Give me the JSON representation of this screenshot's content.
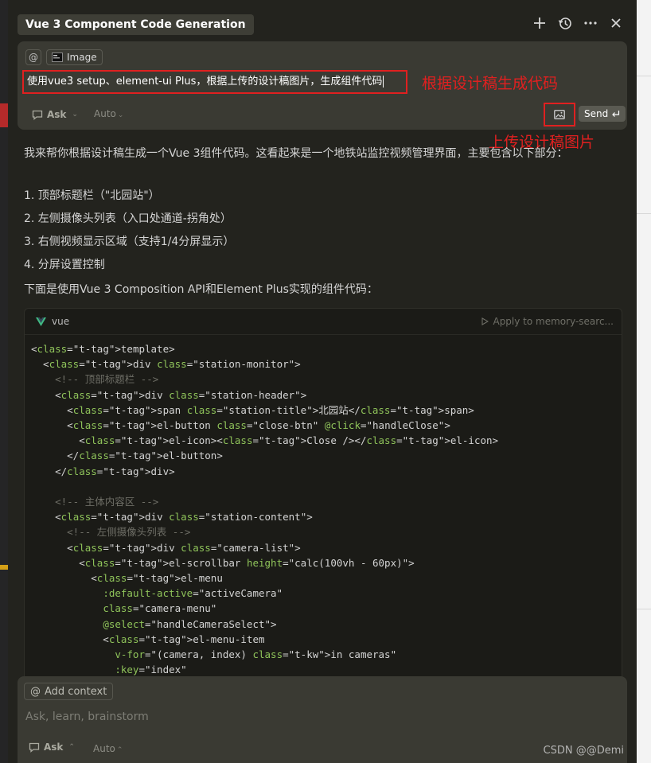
{
  "window": {
    "title": "Vue 3 Component Code Generation",
    "actions": [
      "new-chat-icon",
      "history-icon",
      "more-icon",
      "close-icon"
    ]
  },
  "composer": {
    "at_symbol": "@",
    "attachment_label": "Image",
    "prompt": "使用vue3 setup、element-ui Plus，根据上传的设计稿图片，生成组件代码",
    "mode": "Ask",
    "model": "Auto",
    "send_label": "Send"
  },
  "annotations": {
    "prompt_note": "根据设计稿生成代码",
    "upload_note": "上传设计稿图片"
  },
  "response": {
    "intro": "我来帮你根据设计稿生成一个Vue 3组件代码。这看起来是一个地铁站监控视频管理界面，主要包含以下部分：",
    "items": [
      "1. 顶部标题栏（\"北园站\"）",
      "2. 左侧摄像头列表（入口处通道-拐角处）",
      "3. 右侧视频显示区域（支持1/4分屏显示）",
      "4. 分屏设置控制"
    ],
    "lead": "下面是使用Vue 3 Composition API和Element Plus实现的组件代码："
  },
  "code_block": {
    "language": "vue",
    "apply_label": "Apply to memory-searc...",
    "lines": [
      "<template>",
      "  <div class=\"station-monitor\">",
      "    <!-- 顶部标题栏 -->",
      "    <div class=\"station-header\">",
      "      <span class=\"station-title\">北园站</span>",
      "      <el-button class=\"close-btn\" @click=\"handleClose\">",
      "        <el-icon><Close /></el-icon>",
      "      </el-button>",
      "    </div>",
      "",
      "    <!-- 主体内容区 -->",
      "    <div class=\"station-content\">",
      "      <!-- 左侧摄像头列表 -->",
      "      <div class=\"camera-list\">",
      "        <el-scrollbar height=\"calc(100vh - 60px)\">",
      "          <el-menu",
      "            :default-active=\"activeCamera\"",
      "            class=\"camera-menu\"",
      "            @select=\"handleCameraSelect\">",
      "            <el-menu-item",
      "              v-for=\"(camera, index) in cameras\"",
      "              :key=\"index\""
    ]
  },
  "bottom_composer": {
    "context_label": "Add context",
    "placeholder": "Ask, learn, brainstorm",
    "mode": "Ask",
    "model": "Auto"
  },
  "watermark": "CSDN @@Demi",
  "colors": {
    "panel_bg": "#23231e",
    "composer_bg": "#3a3a33",
    "annotation_red": "#e02020",
    "code_bg": "#1b1b17"
  }
}
